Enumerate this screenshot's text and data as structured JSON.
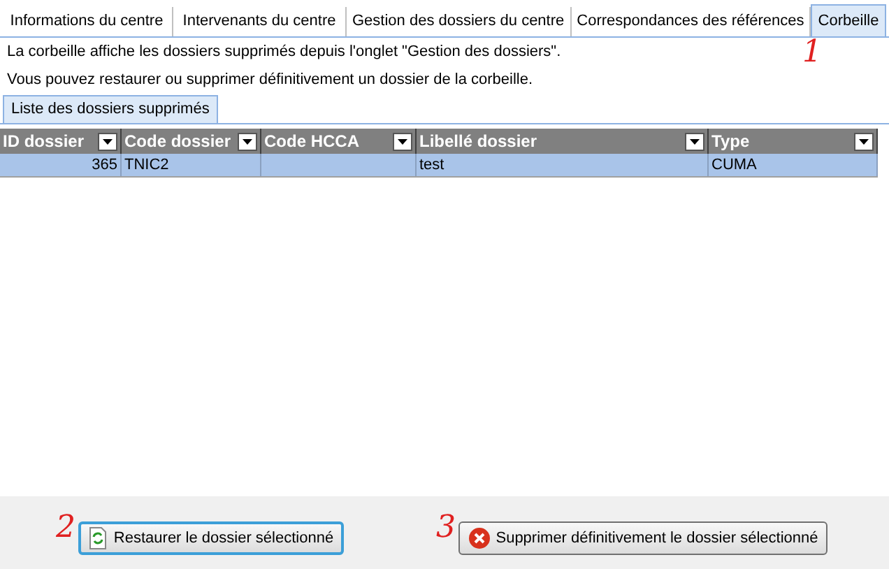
{
  "tabs": [
    {
      "label": "Informations du centre",
      "selected": false
    },
    {
      "label": "Intervenants du centre",
      "selected": false
    },
    {
      "label": "Gestion des dossiers du centre",
      "selected": false
    },
    {
      "label": "Correspondances des références",
      "selected": false
    },
    {
      "label": "Corbeille",
      "selected": true
    }
  ],
  "annotations": [
    "1",
    "2",
    "3"
  ],
  "description": [
    "La corbeille affiche les dossiers supprimés depuis l'onglet \"Gestion des dossiers\".",
    "Vous pouvez restaurer ou supprimer définitivement un dossier de la corbeille."
  ],
  "subtabs": [
    {
      "label": "Liste des dossiers supprimés",
      "selected": true
    }
  ],
  "table": {
    "columns": [
      "ID dossier",
      "Code dossier",
      "Code HCCA",
      "Libellé dossier",
      "Type"
    ],
    "rows": [
      {
        "selected": true,
        "cells": [
          "365",
          "TNIC2",
          "",
          "test",
          "CUMA"
        ]
      }
    ]
  },
  "buttons": [
    {
      "kind": "restore",
      "label": "Restaurer le dossier sélectionné",
      "focused": true
    },
    {
      "kind": "delete",
      "label": "Supprimer définitivement le dossier sélectionné",
      "focused": false
    }
  ]
}
